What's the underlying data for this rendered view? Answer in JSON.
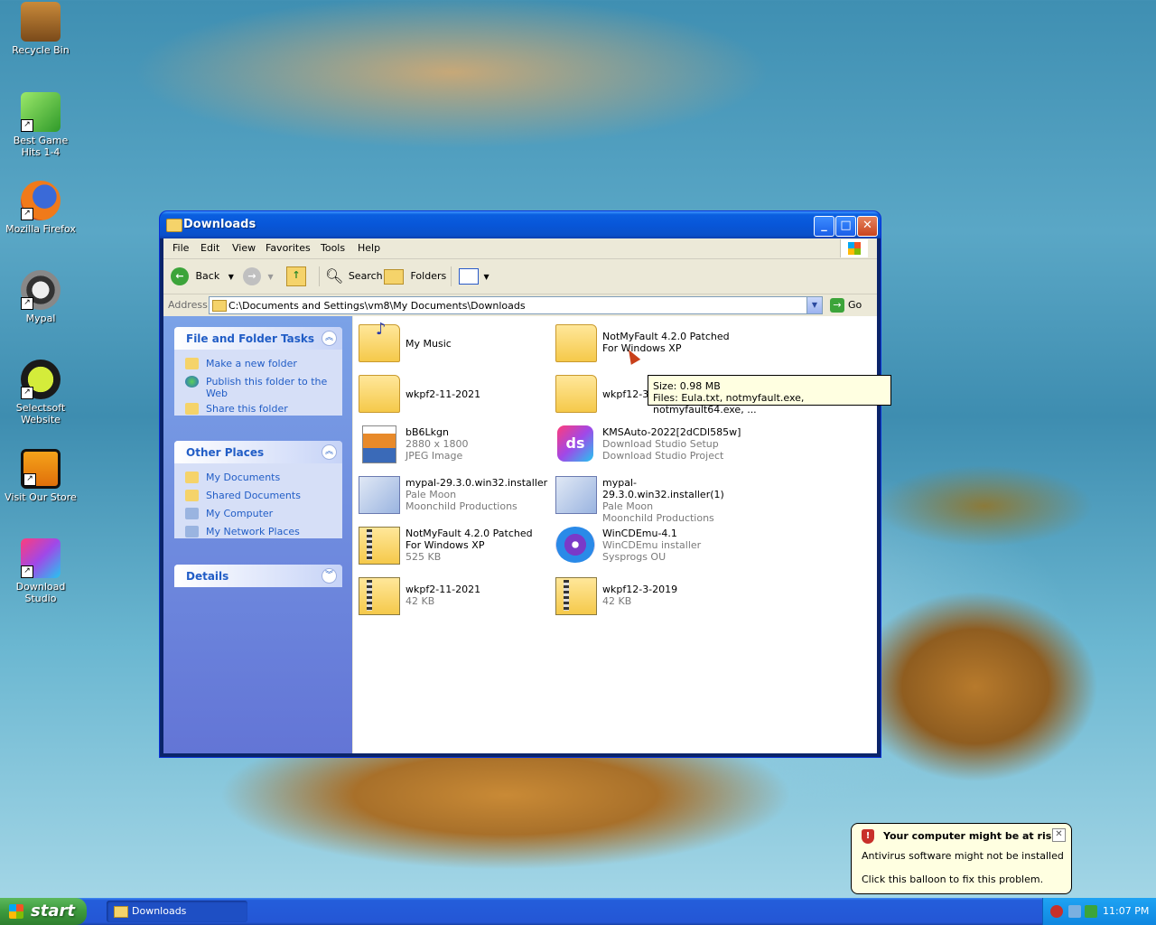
{
  "desktop": {
    "icons": [
      {
        "label": "Recycle Bin",
        "icon": "recycle-bin-icon"
      },
      {
        "label": "Best Game Hits 1-4",
        "icon": "game-dice-icon"
      },
      {
        "label": "Mozilla Firefox",
        "icon": "firefox-icon"
      },
      {
        "label": "Mypal",
        "icon": "mypal-raccoon-icon"
      },
      {
        "label": "Selectsoft Website",
        "icon": "selectsoft-icon"
      },
      {
        "label": "Visit Our Store",
        "icon": "store-icon"
      },
      {
        "label": "Download Studio",
        "icon": "download-studio-icon"
      }
    ]
  },
  "window": {
    "title": "Downloads",
    "menu": [
      "File",
      "Edit",
      "View",
      "Favorites",
      "Tools",
      "Help"
    ],
    "toolbar": {
      "back": "Back",
      "search": "Search",
      "folders": "Folders"
    },
    "address": {
      "label": "Address",
      "value": "C:\\Documents and Settings\\vm8\\My Documents\\Downloads",
      "go": "Go"
    },
    "tasks": {
      "title": "File and Folder Tasks",
      "items": [
        "Make a new folder",
        "Publish this folder to the Web",
        "Share this folder"
      ]
    },
    "places": {
      "title": "Other Places",
      "items": [
        "My Documents",
        "Shared Documents",
        "My Computer",
        "My Network Places"
      ]
    },
    "details": {
      "title": "Details"
    },
    "files": [
      {
        "name": "My Music",
        "l2": "",
        "l3": ""
      },
      {
        "name": "NotMyFault 4.2.0 Patched For Windows XP",
        "l2": "",
        "l3": ""
      },
      {
        "name": "wkpf2-11-2021",
        "l2": "",
        "l3": ""
      },
      {
        "name": "wkpf12-3-",
        "l2": "",
        "l3": ""
      },
      {
        "name": "bB6Lkgn",
        "l2": "2880 x 1800",
        "l3": "JPEG Image"
      },
      {
        "name": "KMSAuto-2022[2dCDl585w]",
        "l2": "Download Studio Setup",
        "l3": "Download Studio Project"
      },
      {
        "name": "mypal-29.3.0.win32.installer",
        "l2": "Pale Moon",
        "l3": "Moonchild Productions"
      },
      {
        "name": "mypal-29.3.0.win32.installer(1)",
        "l2": "Pale Moon",
        "l3": "Moonchild Productions"
      },
      {
        "name": "NotMyFault 4.2.0 Patched For Windows XP",
        "l2": "525 KB",
        "l3": ""
      },
      {
        "name": "WinCDEmu-4.1",
        "l2": "WinCDEmu installer",
        "l3": "Sysprogs OU"
      },
      {
        "name": "wkpf2-11-2021",
        "l2": "42 KB",
        "l3": ""
      },
      {
        "name": "wkpf12-3-2019",
        "l2": "42 KB",
        "l3": ""
      }
    ],
    "tooltip": {
      "line1": "Size: 0.98 MB",
      "line2": "Files: Eula.txt, notmyfault.exe, notmyfault64.exe, ..."
    }
  },
  "taskbar": {
    "start": "start",
    "task": "Downloads",
    "clock": "11:07 PM"
  },
  "balloon": {
    "title": "Your computer might be at risk",
    "line1": "Antivirus software might not be installed",
    "line2": "Click this balloon to fix this problem."
  },
  "colors": {
    "titlebar": "#0a5fe0",
    "taskpane_link": "#215dc6",
    "tooltip_bg": "#ffffe1"
  }
}
